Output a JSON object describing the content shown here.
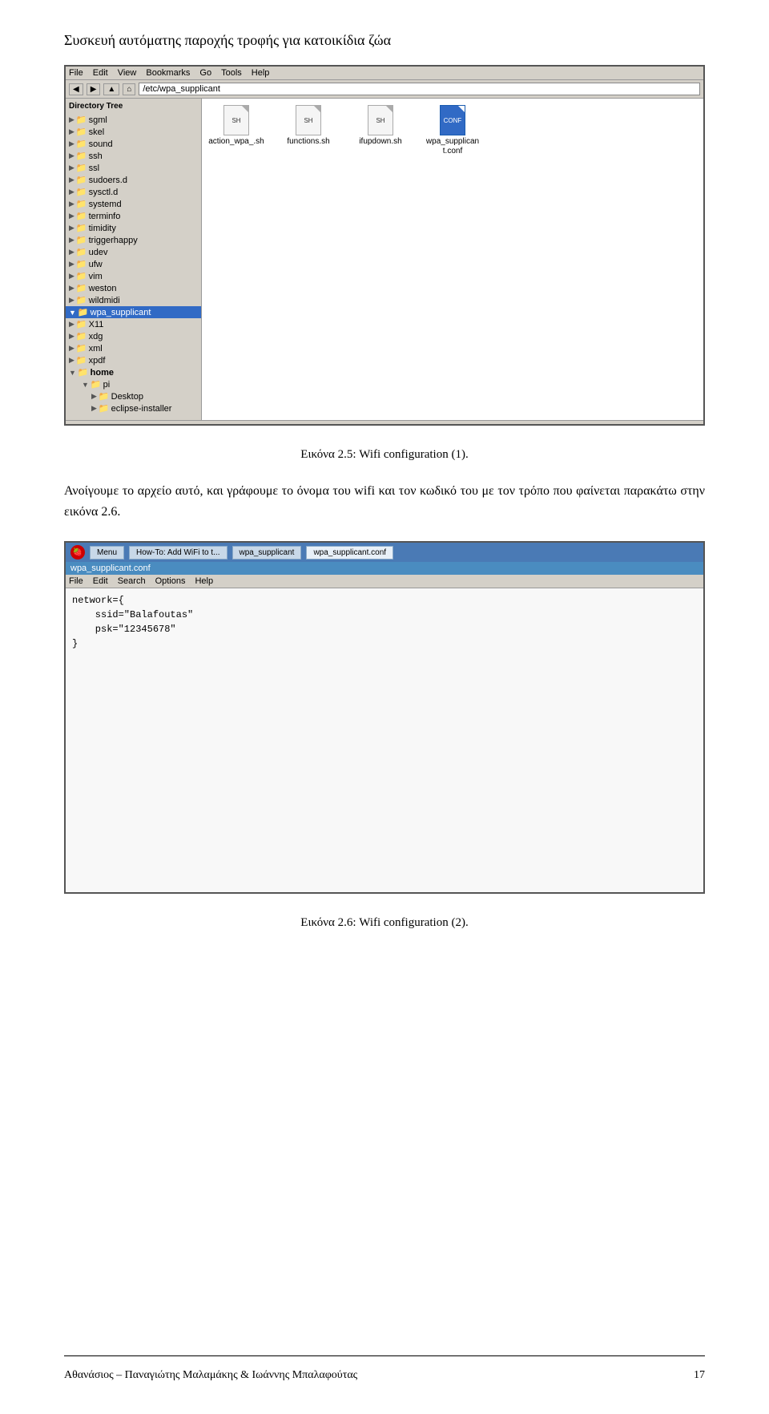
{
  "page": {
    "title": "Συσκευή αυτόματης παροχής τροφής για κατοικίδια ζώα"
  },
  "screenshot1": {
    "menubar": [
      "File",
      "Edit",
      "View",
      "Bookmarks",
      "Go",
      "Tools",
      "Help"
    ],
    "address": "/etc/wpa_supplicant",
    "tree_label": "Directory Tree",
    "tree_items": [
      {
        "label": "sgml",
        "indent": 1,
        "selected": false
      },
      {
        "label": "skel",
        "indent": 1,
        "selected": false
      },
      {
        "label": "sound",
        "indent": 1,
        "selected": false
      },
      {
        "label": "ssh",
        "indent": 1,
        "selected": false
      },
      {
        "label": "ssl",
        "indent": 1,
        "selected": false
      },
      {
        "label": "sudoers.d",
        "indent": 1,
        "selected": false
      },
      {
        "label": "sysctl.d",
        "indent": 1,
        "selected": false
      },
      {
        "label": "systemd",
        "indent": 1,
        "selected": false
      },
      {
        "label": "terminfo",
        "indent": 1,
        "selected": false
      },
      {
        "label": "timidity",
        "indent": 1,
        "selected": false
      },
      {
        "label": "triggerhappy",
        "indent": 1,
        "selected": false
      },
      {
        "label": "udev",
        "indent": 1,
        "selected": false
      },
      {
        "label": "ufw",
        "indent": 1,
        "selected": false
      },
      {
        "label": "vim",
        "indent": 1,
        "selected": false
      },
      {
        "label": "weston",
        "indent": 1,
        "selected": false
      },
      {
        "label": "wildmidi",
        "indent": 1,
        "selected": false
      },
      {
        "label": "wpa_supplicant",
        "indent": 1,
        "selected": true
      },
      {
        "label": "X11",
        "indent": 1,
        "selected": false
      },
      {
        "label": "xdg",
        "indent": 1,
        "selected": false
      },
      {
        "label": "xml",
        "indent": 1,
        "selected": false
      },
      {
        "label": "xpdf",
        "indent": 1,
        "selected": false
      },
      {
        "label": "home",
        "indent": 0,
        "selected": false
      },
      {
        "label": "pi",
        "indent": 1,
        "selected": false
      },
      {
        "label": "Desktop",
        "indent": 2,
        "selected": false
      },
      {
        "label": "eclipse-installer",
        "indent": 2,
        "selected": false
      }
    ],
    "files": [
      {
        "name": "action_wpa_.sh",
        "selected": false
      },
      {
        "name": "functions.sh",
        "selected": false
      },
      {
        "name": "ifupdown.sh",
        "selected": false
      },
      {
        "name": "wpa_supplicant.conf",
        "selected": true
      }
    ]
  },
  "caption1": {
    "text": "Εικόνα 2.5: Wifi configuration (1)."
  },
  "body_text": {
    "text": "Ανοίγουμε το αρχείο αυτό, και γράφουμε το όνομα του wifi και τον κωδικό του με τον τρόπο που φαίνεται παρακάτω στην εικόνα 2.6."
  },
  "screenshot2": {
    "taskbar_items": [
      "Menu",
      "How-To: Add WiFi to t...",
      "wpa_supplicant",
      "wpa_supplicant.conf"
    ],
    "title_bar": "wpa_supplicant.conf",
    "menubar": [
      "File",
      "Edit",
      "Search",
      "Options",
      "Help"
    ],
    "content_lines": [
      "network={",
      "    ssid=\"Balafoutas\"",
      "    psk=\"12345678\"",
      "}"
    ]
  },
  "caption2": {
    "text": "Εικόνα 2.6: Wifi configuration (2)."
  },
  "footer": {
    "author": "Αθανάσιος – Παναγιώτης Μαλαμάκης & Ιωάννης Μπαλαφούτας",
    "page_number": "17"
  }
}
